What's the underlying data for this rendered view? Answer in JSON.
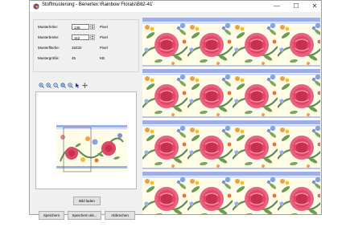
{
  "window": {
    "title": "Stoffmusterung - Benertex:\\Rainbow Florals\\B82-41'",
    "controls": {
      "minimize": "—",
      "maximize": "☐",
      "close": "✕"
    }
  },
  "pattern_properties": {
    "height_label": "Musterhöhe:",
    "height_value": "136",
    "height_unit": "Pixel",
    "width_label": "Musterbreite:",
    "width_value": "112",
    "width_unit": "Pixel",
    "area_label": "Musterfläche:",
    "area_value": "15232",
    "area_unit": "Pixel",
    "size_label": "Mustergröße:",
    "size_value": "45",
    "size_unit": "KB"
  },
  "toolbar": {
    "icons": [
      "zoom-in-icon",
      "zoom-in-alt-icon",
      "zoom-out-icon",
      "zoom-fit-icon",
      "zoom-reset-icon",
      "pointer-icon",
      "move-icon"
    ]
  },
  "buttons": {
    "load_image": "Bild laden",
    "save": "Speichern",
    "save_as": "Speichern als...",
    "cancel": "Abbrechen"
  },
  "colors": {
    "stripe_blue": "#9db0e4",
    "fabric_background": "#fffde8",
    "rose_pink": "#e0456a",
    "leaf_green": "#5e8a4a"
  }
}
